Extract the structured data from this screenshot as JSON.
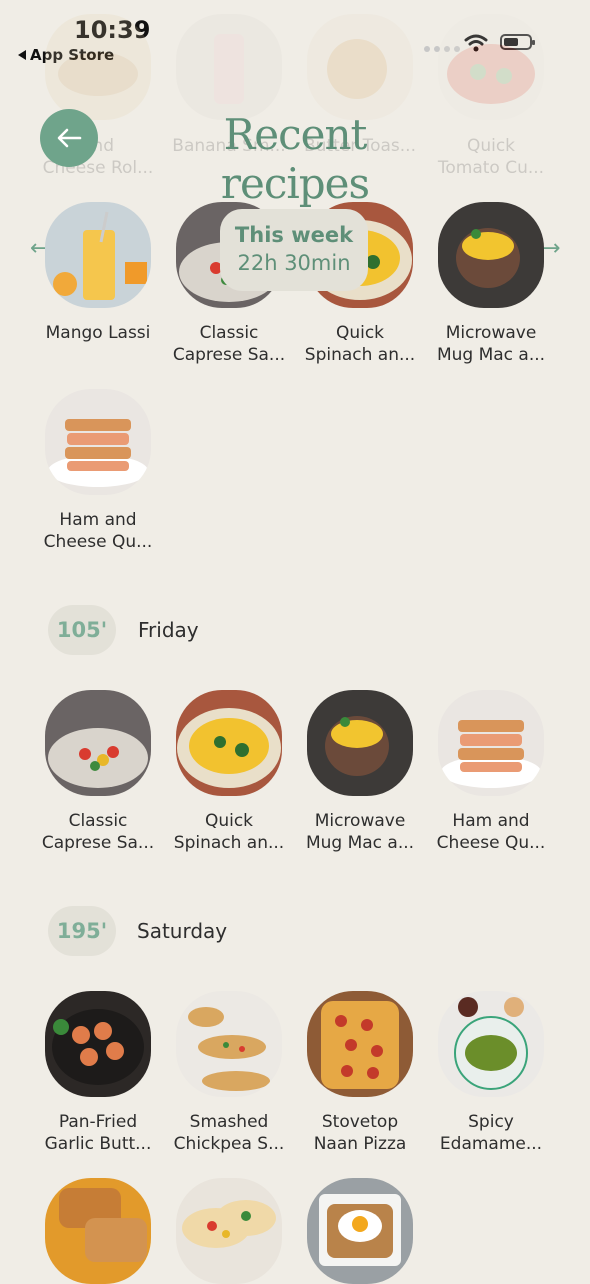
{
  "status": {
    "time": "10:39",
    "back_app": "App Store"
  },
  "header": {
    "title": "Recent recipes",
    "back_icon": "arrow-left-icon"
  },
  "faded_row": [
    {
      "line1": "and",
      "line2": "Cheese Rol..."
    },
    {
      "line1": "",
      "line2": "Banana Sm..."
    },
    {
      "line1": "",
      "line2": "Butter Toas..."
    },
    {
      "line1": "Quick",
      "line2": "Tomato Cu..."
    }
  ],
  "this_week": {
    "label": "This week",
    "total": "22h 30min"
  },
  "week_row": [
    {
      "line1": "Mango Lassi",
      "line2": ""
    },
    {
      "line1": "Classic",
      "line2": "Caprese Sa..."
    },
    {
      "line1": "Quick",
      "line2": "Spinach an..."
    },
    {
      "line1": "Microwave",
      "line2": "Mug Mac a..."
    },
    {
      "line1": "Ham and",
      "line2": "Cheese Qu..."
    }
  ],
  "days": [
    {
      "minutes": "105'",
      "name": "Friday",
      "recipes": [
        {
          "line1": "Classic",
          "line2": "Caprese Sa..."
        },
        {
          "line1": "Quick",
          "line2": "Spinach an..."
        },
        {
          "line1": "Microwave",
          "line2": "Mug Mac a..."
        },
        {
          "line1": "Ham and",
          "line2": "Cheese Qu..."
        }
      ]
    },
    {
      "minutes": "195'",
      "name": "Saturday",
      "recipes": [
        {
          "line1": "Pan-Fried",
          "line2": "Garlic Butt..."
        },
        {
          "line1": "Smashed",
          "line2": "Chickpea S..."
        },
        {
          "line1": "Stovetop",
          "line2": "Naan Pizza"
        },
        {
          "line1": "Spicy",
          "line2": "Edamame..."
        }
      ]
    }
  ],
  "colors": {
    "accent": "#6fa48b",
    "background": "#f0ede6",
    "pill": "#e3e1d8"
  }
}
